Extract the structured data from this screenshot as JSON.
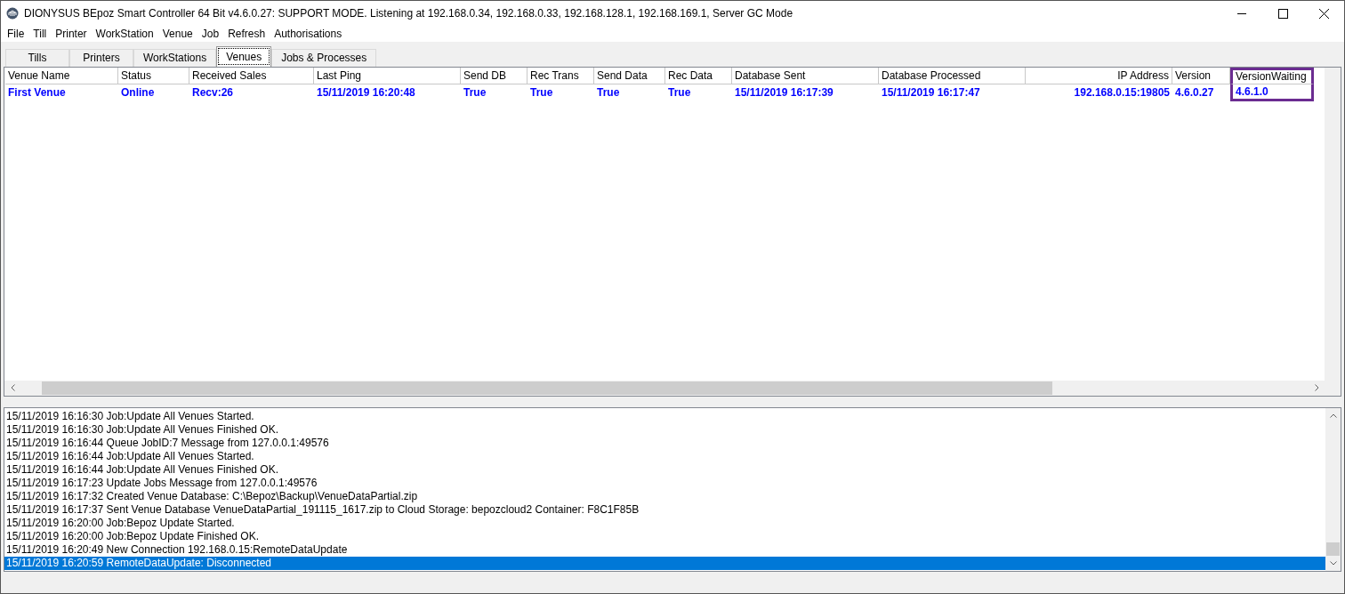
{
  "window": {
    "title": "DIONYSUS BEpoz Smart Controller 64 Bit v4.6.0.27: SUPPORT MODE. Listening at 192.168.0.34, 192.168.0.33, 192.168.128.1, 192.168.169.1,  Server GC Mode"
  },
  "menu": [
    "File",
    "Till",
    "Printer",
    "WorkStation",
    "Venue",
    "Job",
    "Refresh",
    "Authorisations"
  ],
  "tabs": [
    {
      "label": "Tills",
      "selected": false
    },
    {
      "label": "Printers",
      "selected": false
    },
    {
      "label": "WorkStations",
      "selected": false
    },
    {
      "label": "Venues",
      "selected": true
    },
    {
      "label": "Jobs & Processes",
      "selected": false
    }
  ],
  "table": {
    "columns": [
      {
        "label": "Venue Name",
        "highlighted": false
      },
      {
        "label": "Status",
        "highlighted": false
      },
      {
        "label": "Received Sales",
        "highlighted": false
      },
      {
        "label": "Last Ping",
        "highlighted": false
      },
      {
        "label": "Send DB",
        "highlighted": false
      },
      {
        "label": "Rec Trans",
        "highlighted": false
      },
      {
        "label": "Send Data",
        "highlighted": false
      },
      {
        "label": "Rec Data",
        "highlighted": false
      },
      {
        "label": "Database Sent",
        "highlighted": false
      },
      {
        "label": "Database Processed",
        "highlighted": false
      },
      {
        "label": "IP Address",
        "highlighted": false
      },
      {
        "label": "Version",
        "highlighted": false
      },
      {
        "label": "VersionWaiting",
        "highlighted": true
      }
    ],
    "rows": [
      [
        "First Venue",
        "Online",
        "Recv:26",
        "15/11/2019 16:20:48",
        "True",
        "True",
        "True",
        "True",
        "15/11/2019 16:17:39",
        "15/11/2019 16:17:47",
        "192.168.0.15:19805",
        "4.6.0.27",
        "4.6.1.0"
      ]
    ]
  },
  "log": [
    {
      "text": "15/11/2019 16:16:30  Job:Update All Venues Started.",
      "selected": false
    },
    {
      "text": "15/11/2019 16:16:30  Job:Update All Venues Finished OK.",
      "selected": false
    },
    {
      "text": "15/11/2019 16:16:44  Queue JobID:7 Message from 127.0.0.1:49576",
      "selected": false
    },
    {
      "text": "15/11/2019 16:16:44  Job:Update All Venues Started.",
      "selected": false
    },
    {
      "text": "15/11/2019 16:16:44  Job:Update All Venues Finished OK.",
      "selected": false
    },
    {
      "text": "15/11/2019 16:17:23  Update Jobs Message from 127.0.0.1:49576",
      "selected": false
    },
    {
      "text": "15/11/2019 16:17:32  Created Venue Database: C:\\Bepoz\\Backup\\VenueDataPartial.zip",
      "selected": false
    },
    {
      "text": "15/11/2019 16:17:37  Sent Venue Database VenueDataPartial_191115_1617.zip to Cloud Storage: bepozcloud2  Container: F8C1F85B",
      "selected": false
    },
    {
      "text": "15/11/2019 16:20:00  Job:Bepoz Update Started.",
      "selected": false
    },
    {
      "text": "15/11/2019 16:20:00  Job:Bepoz Update Finished OK.",
      "selected": false
    },
    {
      "text": "15/11/2019 16:20:49  New Connection 192.168.0.15:RemoteDataUpdate",
      "selected": false
    },
    {
      "text": "15/11/2019 16:20:59  RemoteDataUpdate:  Disconnected",
      "selected": true
    }
  ]
}
